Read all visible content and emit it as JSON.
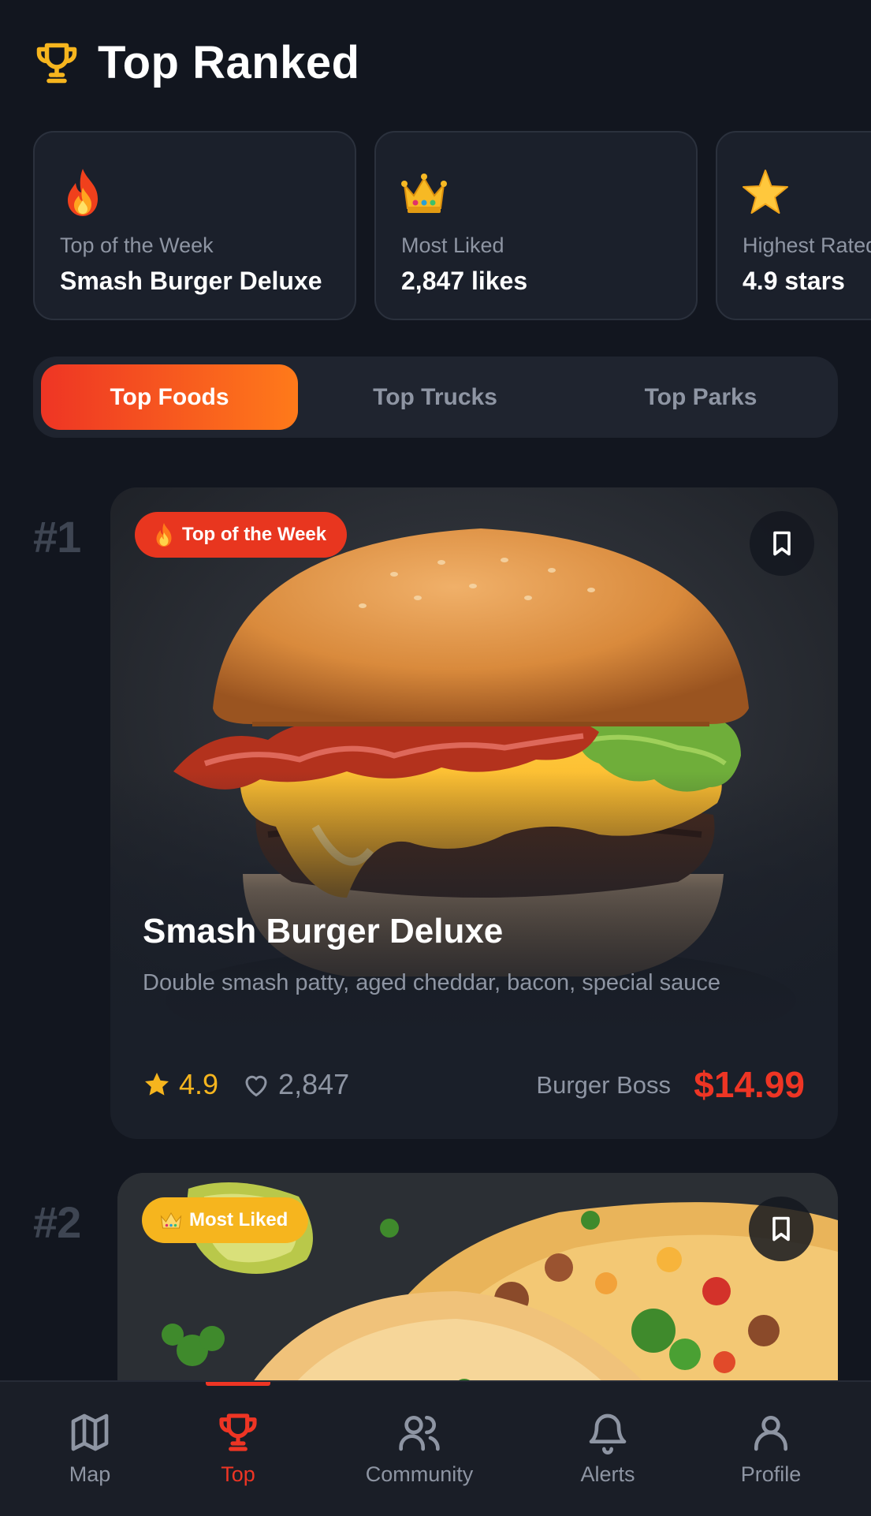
{
  "header": {
    "title": "Top Ranked",
    "icon": "trophy-icon"
  },
  "highlights": [
    {
      "icon": "fire-emoji",
      "label": "Top of the Week",
      "value": "Smash Burger Deluxe"
    },
    {
      "icon": "crown-emoji",
      "label": "Most Liked",
      "value": "2,847 likes"
    },
    {
      "icon": "star-emoji",
      "label": "Highest Rated",
      "value": "4.9 stars"
    }
  ],
  "tabs": [
    {
      "label": "Top Foods",
      "active": true
    },
    {
      "label": "Top Trucks",
      "active": false
    },
    {
      "label": "Top Parks",
      "active": false
    }
  ],
  "items": [
    {
      "rank": "#1",
      "badge": "Top of the Week",
      "badge_icon": "fire-icon",
      "name": "Smash Burger Deluxe",
      "description": "Double smash patty, aged cheddar, bacon, special sauce",
      "rating": "4.9",
      "likes": "2,847",
      "vendor": "Burger Boss",
      "price": "$14.99"
    },
    {
      "rank": "#2",
      "badge": "Most Liked",
      "badge_icon": "crown-icon"
    }
  ],
  "nav": [
    {
      "label": "Map",
      "icon": "map-icon",
      "active": false
    },
    {
      "label": "Top",
      "icon": "trophy-icon",
      "active": true
    },
    {
      "label": "Community",
      "icon": "users-icon",
      "active": false
    },
    {
      "label": "Alerts",
      "icon": "bell-icon",
      "active": false
    },
    {
      "label": "Profile",
      "icon": "user-icon",
      "active": false
    }
  ],
  "colors": {
    "accent": "#ee3524",
    "accent_gradient_end": "#ff7a1a",
    "gold": "#f6b51e",
    "background": "#12161f"
  }
}
